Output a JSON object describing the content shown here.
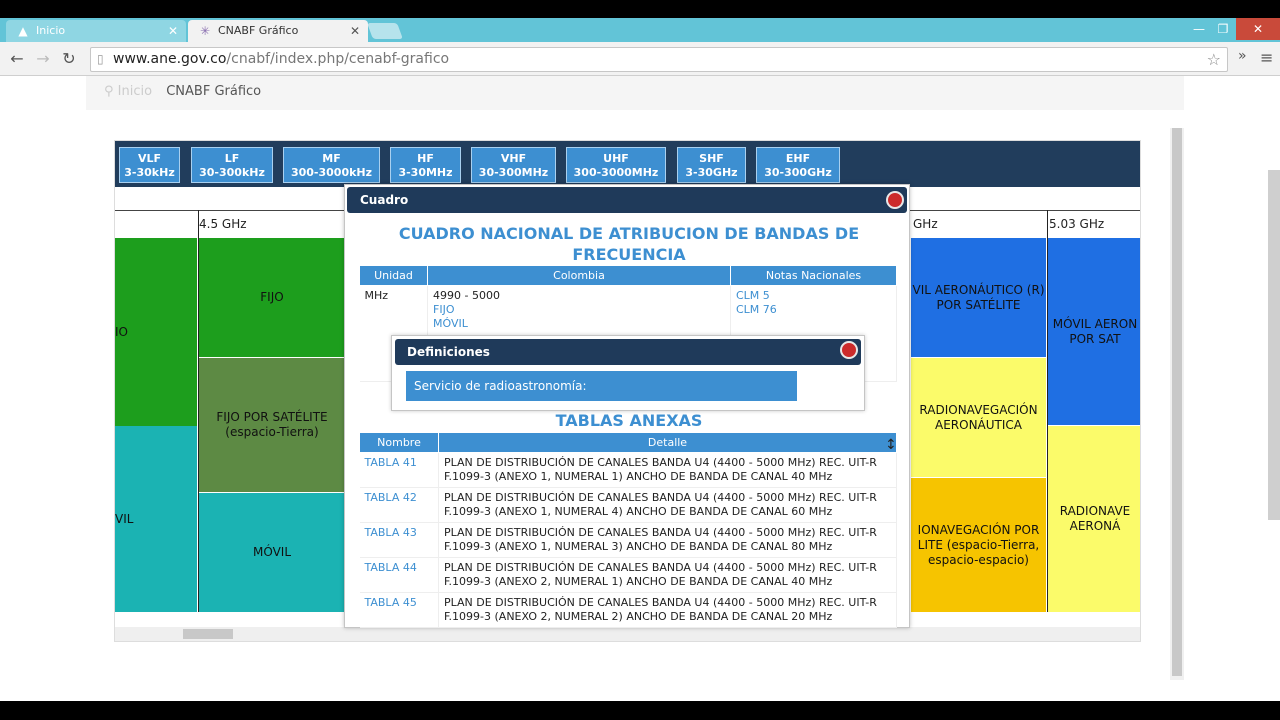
{
  "browser": {
    "tabs": [
      {
        "title": "Inicio",
        "active": false
      },
      {
        "title": "CNABF Gráfico",
        "active": true
      }
    ],
    "url_host": "www.ane.gov.co",
    "url_path": "/cnabf/index.php/cenabf-grafico"
  },
  "breadcrumb": {
    "home": "Inicio",
    "current": "CNABF Gráfico"
  },
  "bands": [
    {
      "name": "VLF",
      "range": "3-30kHz"
    },
    {
      "name": "LF",
      "range": "30-300kHz"
    },
    {
      "name": "MF",
      "range": "300-3000kHz"
    },
    {
      "name": "HF",
      "range": "3-30MHz"
    },
    {
      "name": "VHF",
      "range": "30-300MHz"
    },
    {
      "name": "UHF",
      "range": "300-3000MHz"
    },
    {
      "name": "SHF",
      "range": "3-30GHz"
    },
    {
      "name": "EHF",
      "range": "30-300GHz"
    }
  ],
  "axis": {
    "left_tick": "4.5 GHz",
    "right_partial": "GHz",
    "right_tick": "5.03 GHz"
  },
  "chart_blocks": {
    "left_a": "IO",
    "left_b": "VIL",
    "fijo": "FIJO",
    "fijo_sat": "FIJO POR SATÉLITE (espacio-Tierra)",
    "movil": "MÓVIL",
    "aero_sat": "VIL AERONÁUTICO (R) POR SATÉLITE",
    "radionav_aero": "RADIONAVEGACIÓN AERONÁUTICA",
    "radionav_sat": "IONAVEGACIÓN POR LITE (espacio-Tierra, espacio-espacio)",
    "movil_aero": "MÓVIL AERON POR SAT",
    "radionave": "RADIONAVE AERONÁ"
  },
  "colors": {
    "green": "#1d9e1d",
    "teal": "#1bb3b3",
    "olive": "#5d8a44",
    "blue": "#1f6fe3",
    "yellow": "#fbfb6a",
    "orange": "#f6c400",
    "header_navy": "#1f3a5a",
    "accent_blue": "#3d8fd1"
  },
  "dialog": {
    "header": "Cuadro",
    "title": "CUADRO NACIONAL DE ATRIBUCION DE BANDAS DE FRECUENCIA",
    "table_headers": {
      "unidad": "Unidad",
      "colombia": "Colombia",
      "notas": "Notas Nacionales"
    },
    "row": {
      "unidad": "MHz",
      "range": "4990 - 5000",
      "serv1": "FIJO",
      "serv2": "MÓVIL",
      "nota1": "CLM 5",
      "nota2": "CLM 76"
    },
    "definiciones": {
      "header": "Definiciones",
      "item": "Servicio de radioastronomía:"
    },
    "anexas_title": "TABLAS ANEXAS",
    "anexas_headers": {
      "nombre": "Nombre",
      "detalle": "Detalle"
    },
    "anexas": [
      {
        "nombre": "TABLA 41",
        "detalle": "PLAN DE DISTRIBUCIÓN DE CANALES BANDA U4 (4400 - 5000 MHz) REC. UIT-R F.1099-3 (ANEXO 1, NUMERAL 1) ANCHO DE BANDA DE CANAL 40 MHz"
      },
      {
        "nombre": "TABLA 42",
        "detalle": "PLAN DE DISTRIBUCIÓN DE CANALES BANDA U4 (4400 - 5000 MHz) REC. UIT-R F.1099-3 (ANEXO 1, NUMERAL 4) ANCHO DE BANDA DE CANAL 60 MHz"
      },
      {
        "nombre": "TABLA 43",
        "detalle": "PLAN DE DISTRIBUCIÓN DE CANALES BANDA U4 (4400 - 5000 MHz) REC. UIT-R F.1099-3 (ANEXO 1, NUMERAL 3) ANCHO DE BANDA DE CANAL 80 MHz"
      },
      {
        "nombre": "TABLA 44",
        "detalle": "PLAN DE DISTRIBUCIÓN DE CANALES BANDA U4 (4400 - 5000 MHz) REC. UIT-R F.1099-3 (ANEXO 2, NUMERAL 1) ANCHO DE BANDA DE CANAL 40 MHz"
      },
      {
        "nombre": "TABLA 45",
        "detalle": "PLAN DE DISTRIBUCIÓN DE CANALES BANDA U4 (4400 - 5000 MHz) REC. UIT-R F.1099-3 (ANEXO 2, NUMERAL 2) ANCHO DE BANDA DE CANAL 20 MHz"
      }
    ]
  }
}
